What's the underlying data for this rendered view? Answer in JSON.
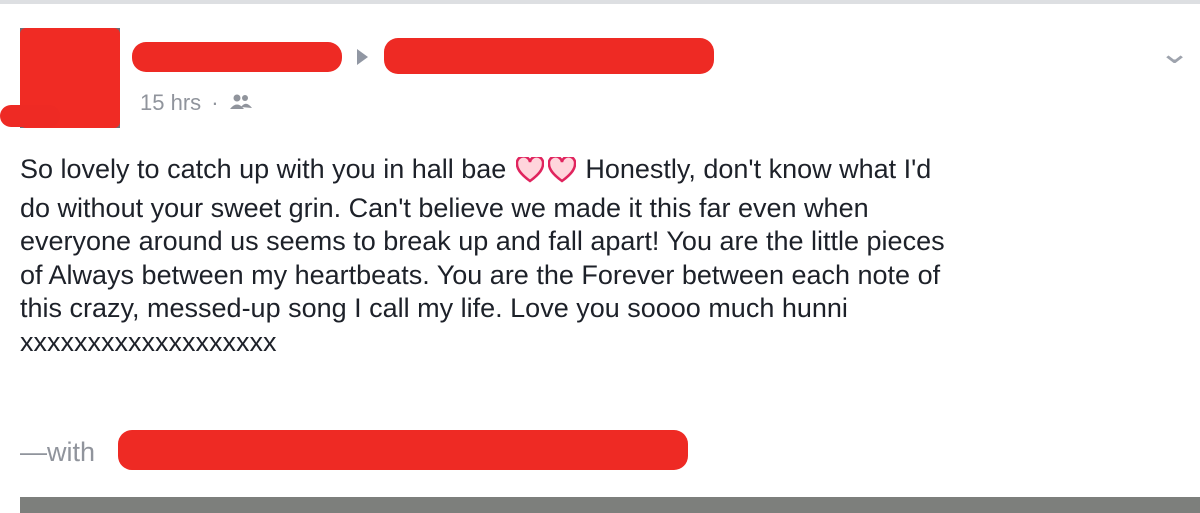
{
  "post": {
    "timestamp": "15 hrs",
    "separator": "·",
    "audience_icon": "friends-icon",
    "menu_icon": "chevron-down-icon",
    "body_part1": "So lovely to catch up with you in hall bae",
    "body_emoji": "heart-emoji",
    "body_part2": "Honestly, don't know what I'd\ndo without your sweet grin. Can't believe we made it this far even when\neveryone around us seems to break up and fall apart! You are the little pieces\nof Always between my heartbeats. You are the Forever between each note of\nthis crazy, messed-up song I call my life. Love you soooo much hunni",
    "body_xs": "xxxxxxxxxxxxxxxxxxx",
    "with_label": "—with"
  },
  "colors": {
    "text": "#1d2129",
    "meta": "#90949c",
    "redaction": "#ee2a24",
    "heart_outline": "#e0245e",
    "heart_fill": "#ffd5dc"
  }
}
